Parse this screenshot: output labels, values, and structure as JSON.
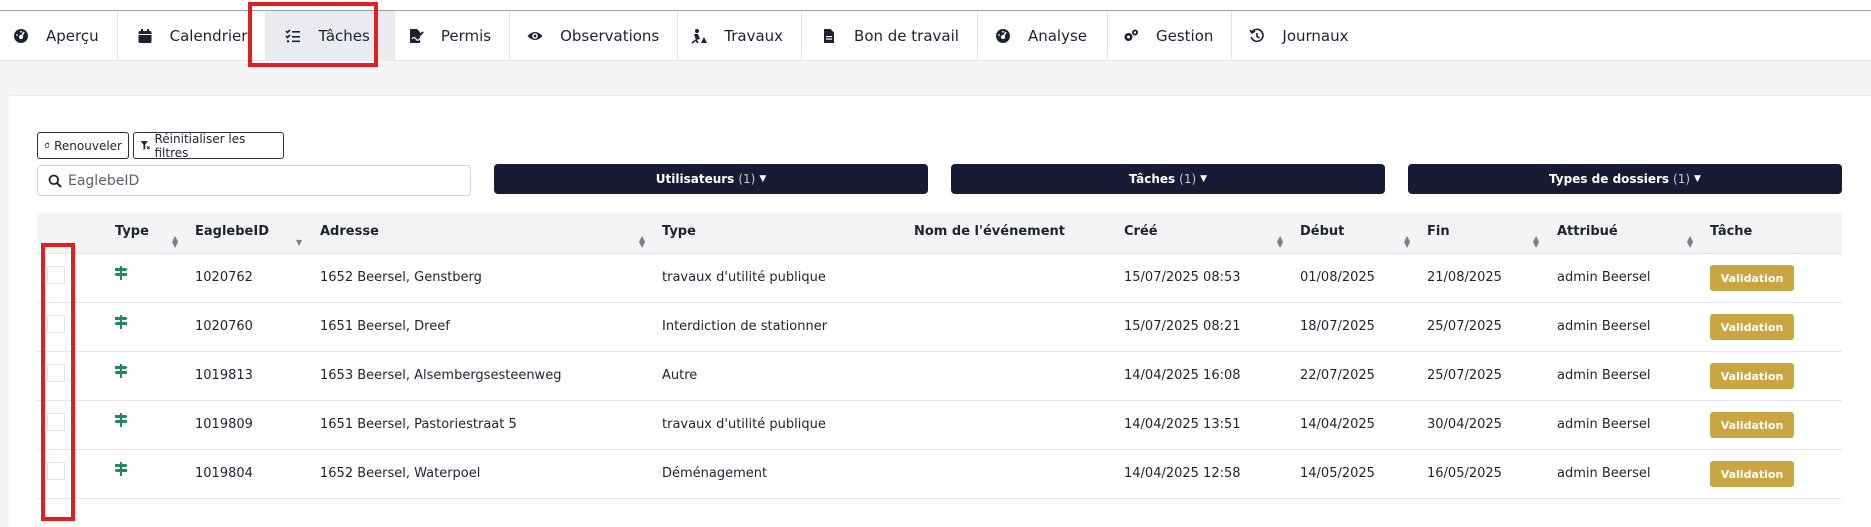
{
  "nav": {
    "tabs": [
      {
        "label": "Aperçu",
        "icon": "gauge-icon"
      },
      {
        "label": "Calendrier",
        "icon": "calendar-icon"
      },
      {
        "label": "Tâches",
        "icon": "task-list-icon",
        "active": true
      },
      {
        "label": "Permis",
        "icon": "signed-document-icon"
      },
      {
        "label": "Observations",
        "icon": "eye-icon"
      },
      {
        "label": "Travaux",
        "icon": "roadwork-worker-icon"
      },
      {
        "label": "Bon de travail",
        "icon": "file-icon"
      },
      {
        "label": "Analyse",
        "icon": "gauge-icon"
      },
      {
        "label": "Gestion",
        "icon": "gears-icon"
      },
      {
        "label": "Journaux",
        "icon": "history-icon"
      }
    ]
  },
  "toolbar": {
    "renew_label": "Renouveler",
    "reset_filters_label": "Réinitialiser les filtres"
  },
  "search": {
    "placeholder": "EaglebeID"
  },
  "filters": {
    "users": {
      "label": "Utilisateurs",
      "count": "(1)"
    },
    "tasks": {
      "label": "Tâches",
      "count": "(1)"
    },
    "types": {
      "label": "Types de dossiers",
      "count": "(1)"
    }
  },
  "table": {
    "headers": {
      "type": "Type",
      "eaglebe_id": "EaglebeID",
      "address": "Adresse",
      "dossier_type": "Type",
      "event_name": "Nom de l'événement",
      "created": "Créé",
      "start": "Début",
      "end": "Fin",
      "assigned": "Attribué",
      "task": "Tâche"
    },
    "rows": [
      {
        "type_icon": "signpost-icon",
        "id": "1020762",
        "address": "1652 Beersel, Genstberg",
        "type": "travaux d'utilité publique",
        "event": "",
        "created": "15/07/2025 08:53",
        "start": "01/08/2025",
        "end": "21/08/2025",
        "assigned": "admin Beersel",
        "task": "Validation"
      },
      {
        "type_icon": "signpost-icon",
        "id": "1020760",
        "address": "1651 Beersel, Dreef",
        "type": "Interdiction de stationner",
        "event": "",
        "created": "15/07/2025 08:21",
        "start": "18/07/2025",
        "end": "25/07/2025",
        "assigned": "admin Beersel",
        "task": "Validation"
      },
      {
        "type_icon": "signpost-icon",
        "id": "1019813",
        "address": "1653 Beersel, Alsembergsesteenweg",
        "type": "Autre",
        "event": "",
        "created": "14/04/2025 16:08",
        "start": "22/07/2025",
        "end": "25/07/2025",
        "assigned": "admin Beersel",
        "task": "Validation"
      },
      {
        "type_icon": "signpost-icon",
        "id": "1019809",
        "address": "1651 Beersel, Pastoriestraat 5",
        "type": "travaux d'utilité publique",
        "event": "",
        "created": "14/04/2025 13:51",
        "start": "14/04/2025",
        "end": "30/04/2025",
        "assigned": "admin Beersel",
        "task": "Validation"
      },
      {
        "type_icon": "signpost-icon",
        "id": "1019804",
        "address": "1652 Beersel, Waterpoel",
        "type": "Déménagement",
        "event": "",
        "created": "14/04/2025 12:58",
        "start": "14/05/2025",
        "end": "16/05/2025",
        "assigned": "admin Beersel",
        "task": "Validation"
      }
    ]
  },
  "colors": {
    "navy": "#151c33",
    "badge_gold": "#c9a640",
    "type_icon_green": "#1f8a5b",
    "highlight_red": "#e02020"
  }
}
